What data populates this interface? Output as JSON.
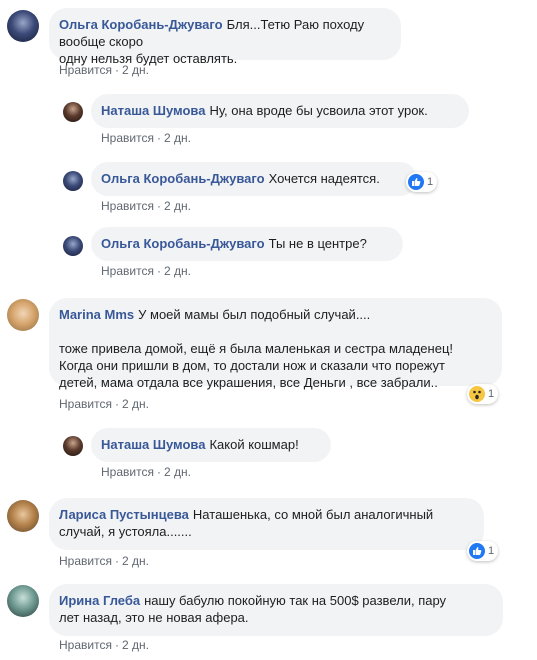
{
  "colors": {
    "author": "#385898",
    "bubble": "#f2f3f5",
    "meta": "#606770",
    "like_reaction": "#2078f4",
    "wow_reaction": "#f7c640"
  },
  "comments": [
    {
      "author": "Ольга Коробань-Джуваго",
      "text": "Бля...Тетю Раю походу вообще скоро\nодну нельзя будет оставлять.",
      "like_label": "Нравится",
      "time": "2 дн."
    },
    {
      "author": "Наташа Шумова",
      "text": "Ну, она вроде бы усвоила этот урок.",
      "like_label": "Нравится",
      "time": "2 дн."
    },
    {
      "author": "Ольга Коробань-Джуваго",
      "text": "Хочется надеятся.",
      "like_label": "Нравится",
      "time": "2 дн.",
      "reaction": {
        "icon": "like-reaction-icon",
        "count": "1"
      }
    },
    {
      "author": "Ольга Коробань-Джуваго",
      "text": "Ты не в центре?",
      "like_label": "Нравится",
      "time": "2 дн."
    },
    {
      "author": "Marina Mms",
      "text": "У моей мамы был подобный случай....\n\nтоже привела домой, ещё я была маленькая и сестра младенец!\nКогда они пришли в дом, то достали нож и сказали что порежут\nдетей, мама отдала все украшения, все Деньги , все забрали..",
      "like_label": "Нравится",
      "time": "2 дн.",
      "reaction": {
        "icon": "wow-reaction-icon",
        "count": "1"
      }
    },
    {
      "author": "Наташа Шумова",
      "text": "Какой кошмар!",
      "like_label": "Нравится",
      "time": "2 дн."
    },
    {
      "author": "Лариса Пустынцева",
      "text": "Наташенька, со мной был аналогичный\nслучай, я устояла.......",
      "like_label": "Нравится",
      "time": "2 дн.",
      "reaction": {
        "icon": "like-reaction-icon",
        "count": "1"
      }
    },
    {
      "author": "Ирина Глеба",
      "text": "нашу бабулю покойную так на 500$ развели, пару\nлет назад, это не новая афера.",
      "like_label": "Нравится",
      "time": "2 дн."
    }
  ]
}
